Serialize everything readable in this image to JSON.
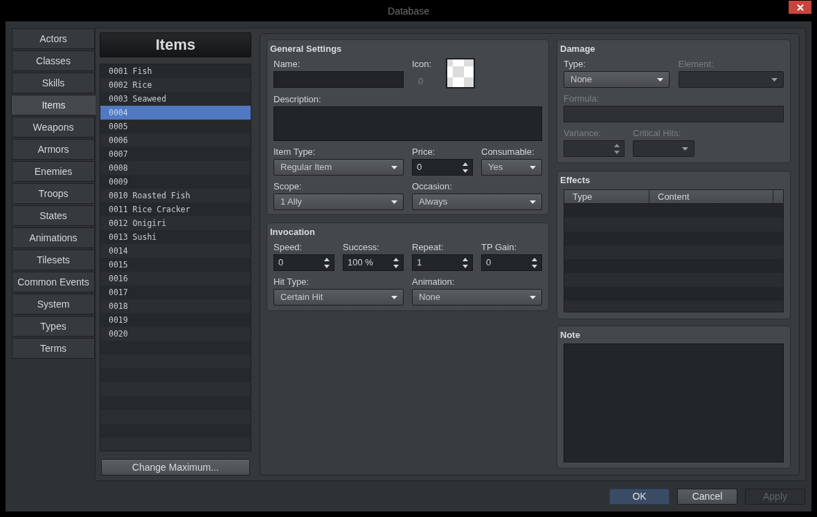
{
  "window": {
    "title": "Database"
  },
  "categories": [
    {
      "label": "Actors",
      "selected": false
    },
    {
      "label": "Classes",
      "selected": false
    },
    {
      "label": "Skills",
      "selected": false
    },
    {
      "label": "Items",
      "selected": true
    },
    {
      "label": "Weapons",
      "selected": false
    },
    {
      "label": "Armors",
      "selected": false
    },
    {
      "label": "Enemies",
      "selected": false
    },
    {
      "label": "Troops",
      "selected": false
    },
    {
      "label": "States",
      "selected": false
    },
    {
      "label": "Animations",
      "selected": false
    },
    {
      "label": "Tilesets",
      "selected": false
    },
    {
      "label": "Common Events",
      "selected": false
    },
    {
      "label": "System",
      "selected": false
    },
    {
      "label": "Types",
      "selected": false
    },
    {
      "label": "Terms",
      "selected": false
    }
  ],
  "item_list": {
    "title": "Items",
    "items": [
      {
        "label": "0001 Fish",
        "selected": false
      },
      {
        "label": "0002 Rice",
        "selected": false
      },
      {
        "label": "0003 Seaweed",
        "selected": false
      },
      {
        "label": "0004",
        "selected": true
      },
      {
        "label": "0005",
        "selected": false
      },
      {
        "label": "0006",
        "selected": false
      },
      {
        "label": "0007",
        "selected": false
      },
      {
        "label": "0008",
        "selected": false
      },
      {
        "label": "0009",
        "selected": false
      },
      {
        "label": "0010 Roasted Fish",
        "selected": false
      },
      {
        "label": "0011 Rice Cracker",
        "selected": false
      },
      {
        "label": "0012 Onigiri",
        "selected": false
      },
      {
        "label": "0013 Sushi",
        "selected": false
      },
      {
        "label": "0014",
        "selected": false
      },
      {
        "label": "0015",
        "selected": false
      },
      {
        "label": "0016",
        "selected": false
      },
      {
        "label": "0017",
        "selected": false
      },
      {
        "label": "0018",
        "selected": false
      },
      {
        "label": "0019",
        "selected": false
      },
      {
        "label": "0020",
        "selected": false
      }
    ],
    "change_maximum_button": "Change Maximum..."
  },
  "general_settings": {
    "title": "General Settings",
    "name": {
      "label": "Name:"
    },
    "icon": {
      "label": "Icon:",
      "index": "0"
    },
    "description": {
      "label": "Description:"
    },
    "item_type": {
      "label": "Item Type:",
      "value": "Regular Item"
    },
    "price": {
      "label": "Price:",
      "value": "0"
    },
    "consumable": {
      "label": "Consumable:",
      "value": "Yes"
    },
    "scope": {
      "label": "Scope:",
      "value": "1 Ally"
    },
    "occasion": {
      "label": "Occasion:",
      "value": "Always"
    }
  },
  "invocation": {
    "title": "Invocation",
    "speed": {
      "label": "Speed:",
      "value": "0"
    },
    "success": {
      "label": "Success:",
      "value": "100 %"
    },
    "repeat": {
      "label": "Repeat:",
      "value": "1"
    },
    "tp_gain": {
      "label": "TP Gain:",
      "value": "0"
    },
    "hit_type": {
      "label": "Hit Type:",
      "value": "Certain Hit"
    },
    "animation": {
      "label": "Animation:",
      "value": "None"
    }
  },
  "damage": {
    "title": "Damage",
    "type": {
      "label": "Type:",
      "value": "None",
      "disabled": false
    },
    "element": {
      "label": "Element:",
      "disabled": true
    },
    "formula": {
      "label": "Formula:",
      "disabled": true
    },
    "variance": {
      "label": "Variance:",
      "disabled": true
    },
    "critical_hits": {
      "label": "Critical Hits:",
      "disabled": true
    }
  },
  "effects": {
    "title": "Effects",
    "columns": [
      "Type",
      "Content"
    ]
  },
  "note": {
    "title": "Note"
  },
  "buttons": [
    {
      "label": "OK",
      "default": true,
      "disabled": false
    },
    {
      "label": "Cancel",
      "default": false,
      "disabled": false
    },
    {
      "label": "Apply",
      "default": false,
      "disabled": true
    }
  ]
}
